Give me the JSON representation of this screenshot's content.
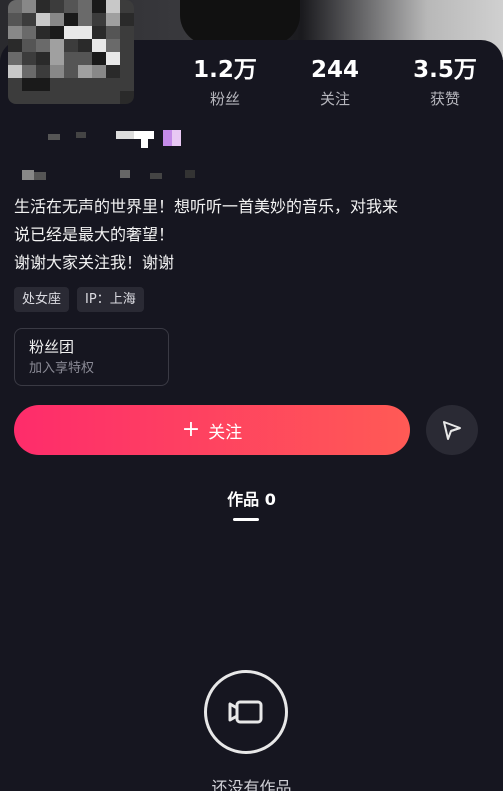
{
  "stats": [
    {
      "value": "1.2万",
      "label": "粉丝"
    },
    {
      "value": "244",
      "label": "关注"
    },
    {
      "value": "3.5万",
      "label": "获赞"
    }
  ],
  "bio": {
    "line1": "生活在无声的世界里！想听听一首美妙的音乐，对我来",
    "line2": "说已经是最大的奢望！",
    "line3": "谢谢大家关注我！谢谢"
  },
  "tags": [
    "处女座",
    "IP：上海"
  ],
  "fan_group": {
    "title": "粉丝团",
    "subtitle": "加入享特权"
  },
  "follow_button": {
    "label": "关注"
  },
  "tabs": [
    {
      "label": "作品 0"
    }
  ],
  "empty_state": {
    "text": "还没有作品"
  },
  "colors": {
    "background": "#161620",
    "accent_start": "#fe2c6b",
    "accent_end": "#ff5a55"
  }
}
